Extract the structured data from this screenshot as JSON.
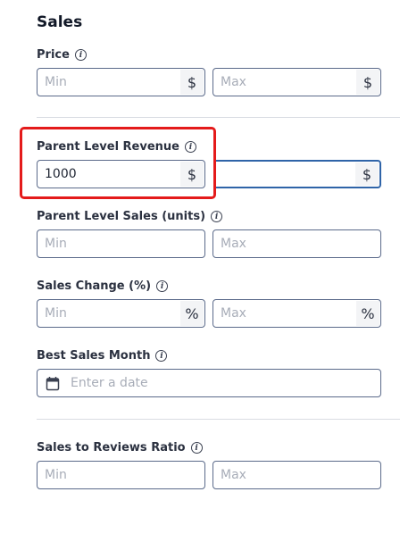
{
  "section": {
    "title": "Sales"
  },
  "price": {
    "label": "Price",
    "min_placeholder": "Min",
    "max_placeholder": "Max",
    "suffix": "$"
  },
  "parent_revenue": {
    "label": "Parent Level Revenue",
    "min_value": "1000",
    "max_value": "",
    "suffix": "$"
  },
  "parent_sales": {
    "label": "Parent Level Sales (units)",
    "min_placeholder": "Min",
    "max_placeholder": "Max"
  },
  "sales_change": {
    "label": "Sales Change (%)",
    "min_placeholder": "Min",
    "max_placeholder": "Max",
    "suffix": "%"
  },
  "best_month": {
    "label": "Best Sales Month",
    "placeholder": "Enter a date",
    "icon": "calendar-icon"
  },
  "reviews_ratio": {
    "label": "Sales to Reviews Ratio",
    "min_placeholder": "Min",
    "max_placeholder": "Max"
  },
  "colors": {
    "highlight": "#e41b1b",
    "active_border": "#2f64a8",
    "field_border": "#5b6a8a"
  }
}
